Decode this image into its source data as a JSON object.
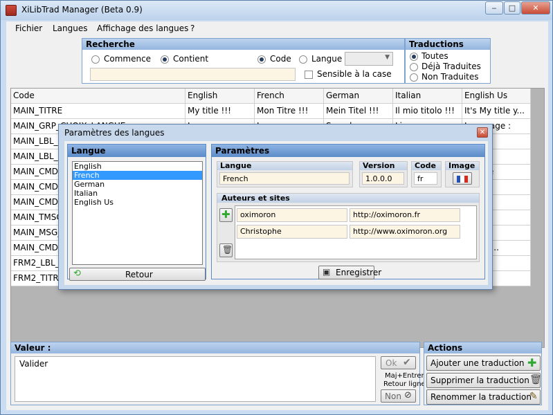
{
  "window": {
    "title": "XiLibTrad Manager (Beta 0.9)",
    "min": "‒",
    "max": "□",
    "close": "✕"
  },
  "menu": [
    "Fichier",
    "Langues",
    "Affichage des langues",
    "?"
  ],
  "search": {
    "title": "Recherche",
    "opt_commence": "Commence",
    "opt_contient": "Contient",
    "opt_code": "Code",
    "opt_langue": "Langue",
    "case_sensitive": "Sensible à la case",
    "text": ""
  },
  "translations": {
    "title": "Traductions",
    "options": [
      "Toutes",
      "Déjà Traduites",
      "Non Traduites"
    ]
  },
  "table": {
    "headers": [
      "Code",
      "English",
      "French",
      "German",
      "Italian",
      "English Us"
    ],
    "rows": [
      [
        "MAIN_TITRE",
        "My title !!!",
        "Mon Titre !!!",
        "Mein Titel !!!",
        "Il mio titolo  !!!",
        "It's My title y..."
      ],
      [
        "MAIN_GRP_CHOIX_LANGUE",
        "Language :",
        "Langue :",
        "Sprache :",
        "Lingua :",
        "Language :"
      ],
      [
        "MAIN_LBL_",
        "",
        "",
        "",
        "",
        ""
      ],
      [
        "MAIN_LBL_",
        "",
        "",
        "",
        "",
        "s) :"
      ],
      [
        "MAIN_CMD_",
        "",
        "",
        "",
        "",
        "essage"
      ],
      [
        "MAIN_CMD_",
        "",
        "",
        "",
        "",
        ""
      ],
      [
        "MAIN_CMD_",
        "",
        "",
        "",
        "",
        ""
      ],
      [
        "MAIN_TMSG",
        "",
        "",
        "",
        "",
        ""
      ],
      [
        "MAIN_MSG_",
        "",
        "",
        "",
        "",
        "!!"
      ],
      [
        "MAIN_CMD_",
        "",
        "",
        "",
        "",
        "nother..."
      ],
      [
        "FRM2_LBL_",
        "",
        "",
        "",
        "",
        ""
      ],
      [
        "FRM2_TITRE",
        "",
        "",
        "",
        "",
        ""
      ]
    ]
  },
  "valeur": {
    "title": "Valeur :",
    "text": "Valider",
    "ok": "Ok",
    "hint1": "Maj+Entrer",
    "hint2": "Retour ligne",
    "non": "Non"
  },
  "actions": {
    "title": "Actions",
    "add": "Ajouter une traduction",
    "delete": "Supprimer la traduction",
    "rename": "Renommer la traduction"
  },
  "dialog": {
    "title": "Paramètres des langues",
    "langue_title": "Langue",
    "languages": [
      "English",
      "French",
      "German",
      "Italian",
      "English Us"
    ],
    "selected_index": 1,
    "retour": "Retour",
    "params_title": "Paramètres",
    "col_langue": "Langue",
    "col_version": "Version",
    "col_code": "Code",
    "col_image": "Image",
    "langue_value": "French",
    "version_value": "1.0.0.0",
    "code_value": "fr",
    "auteurs_title": "Auteurs et sites",
    "authors": [
      {
        "name": "oximoron",
        "site": "http://oximoron.fr"
      },
      {
        "name": "Christophe",
        "site": "http://www.oximoron.org"
      }
    ],
    "save": "Enregistrer"
  }
}
